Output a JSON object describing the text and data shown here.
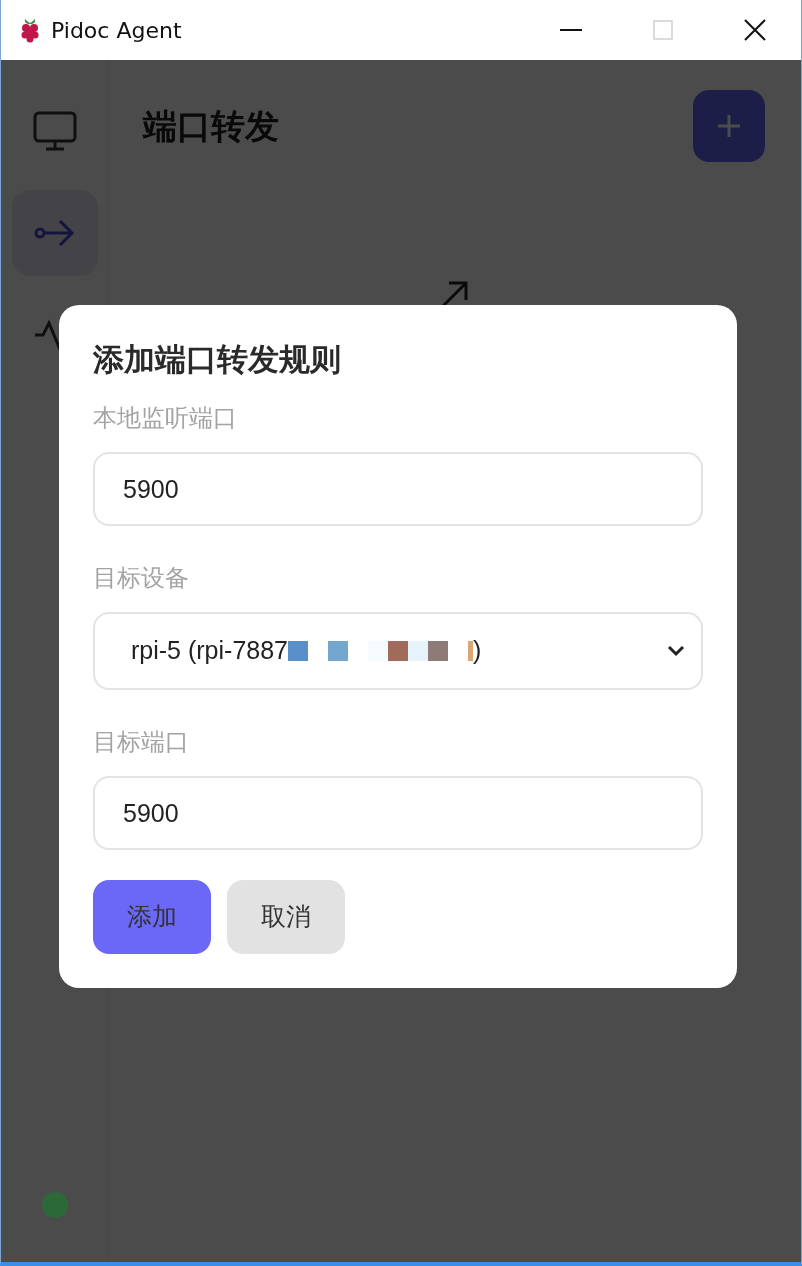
{
  "window": {
    "title": "Pidoc Agent"
  },
  "sidebar": {
    "items": [
      {
        "kind": "devices",
        "selected": false
      },
      {
        "kind": "forward",
        "selected": true
      },
      {
        "kind": "activity",
        "selected": false
      }
    ],
    "status": {
      "color": "#2b6a38"
    }
  },
  "page": {
    "title": "端口转发"
  },
  "dialog": {
    "title": "添加端口转发规则",
    "fields": [
      {
        "kind": "input",
        "label": "本地监听端口",
        "value": "5900"
      },
      {
        "kind": "select",
        "label": "目标设备",
        "value": "rpi-5 (rpi-7887",
        "value_end": ")"
      },
      {
        "kind": "input",
        "label": "目标端口",
        "value": "5900"
      }
    ],
    "buttons": [
      {
        "kind": "primary",
        "label": "添加"
      },
      {
        "kind": "secondary",
        "label": "取消"
      }
    ]
  }
}
